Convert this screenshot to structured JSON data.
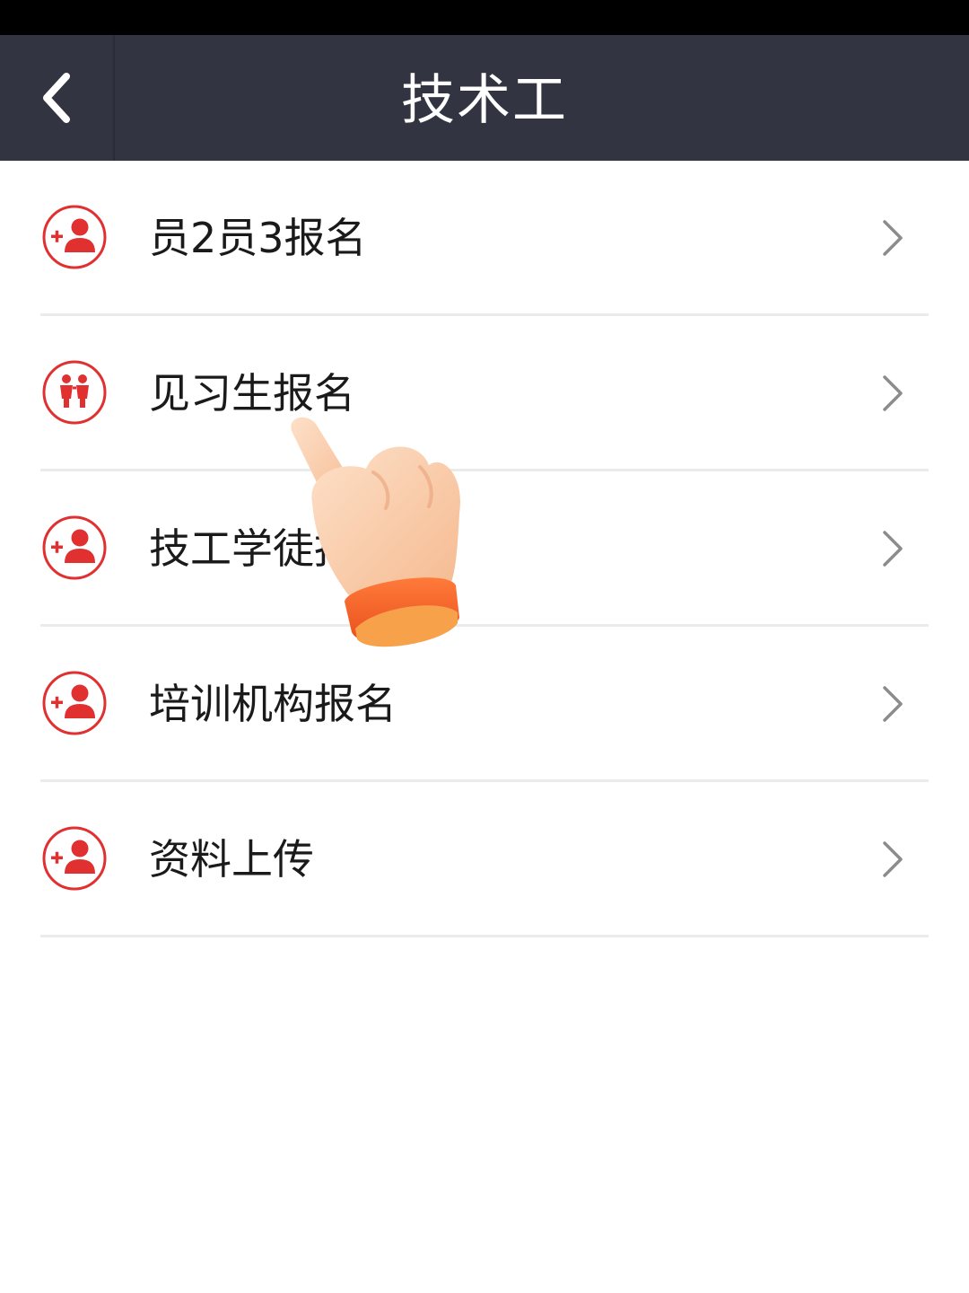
{
  "status_bar": {},
  "nav": {
    "title": "技术工",
    "back_icon": "chevron-left-icon"
  },
  "menu": {
    "items": [
      {
        "label": "员2员3报名",
        "icon": "add-user-icon"
      },
      {
        "label": "见习生报名",
        "icon": "people-icon"
      },
      {
        "label": "技工学徒报名",
        "icon": "add-user-icon"
      },
      {
        "label": "培训机构报名",
        "icon": "add-user-icon"
      },
      {
        "label": "资料上传",
        "icon": "add-user-icon"
      }
    ],
    "chevron_icon": "chevron-right-icon"
  },
  "overlay": {
    "icon": "pointing-hand-icon"
  },
  "colors": {
    "nav_bg": "#323541",
    "accent_red": "#e03030",
    "divider": "#ebebeb"
  }
}
